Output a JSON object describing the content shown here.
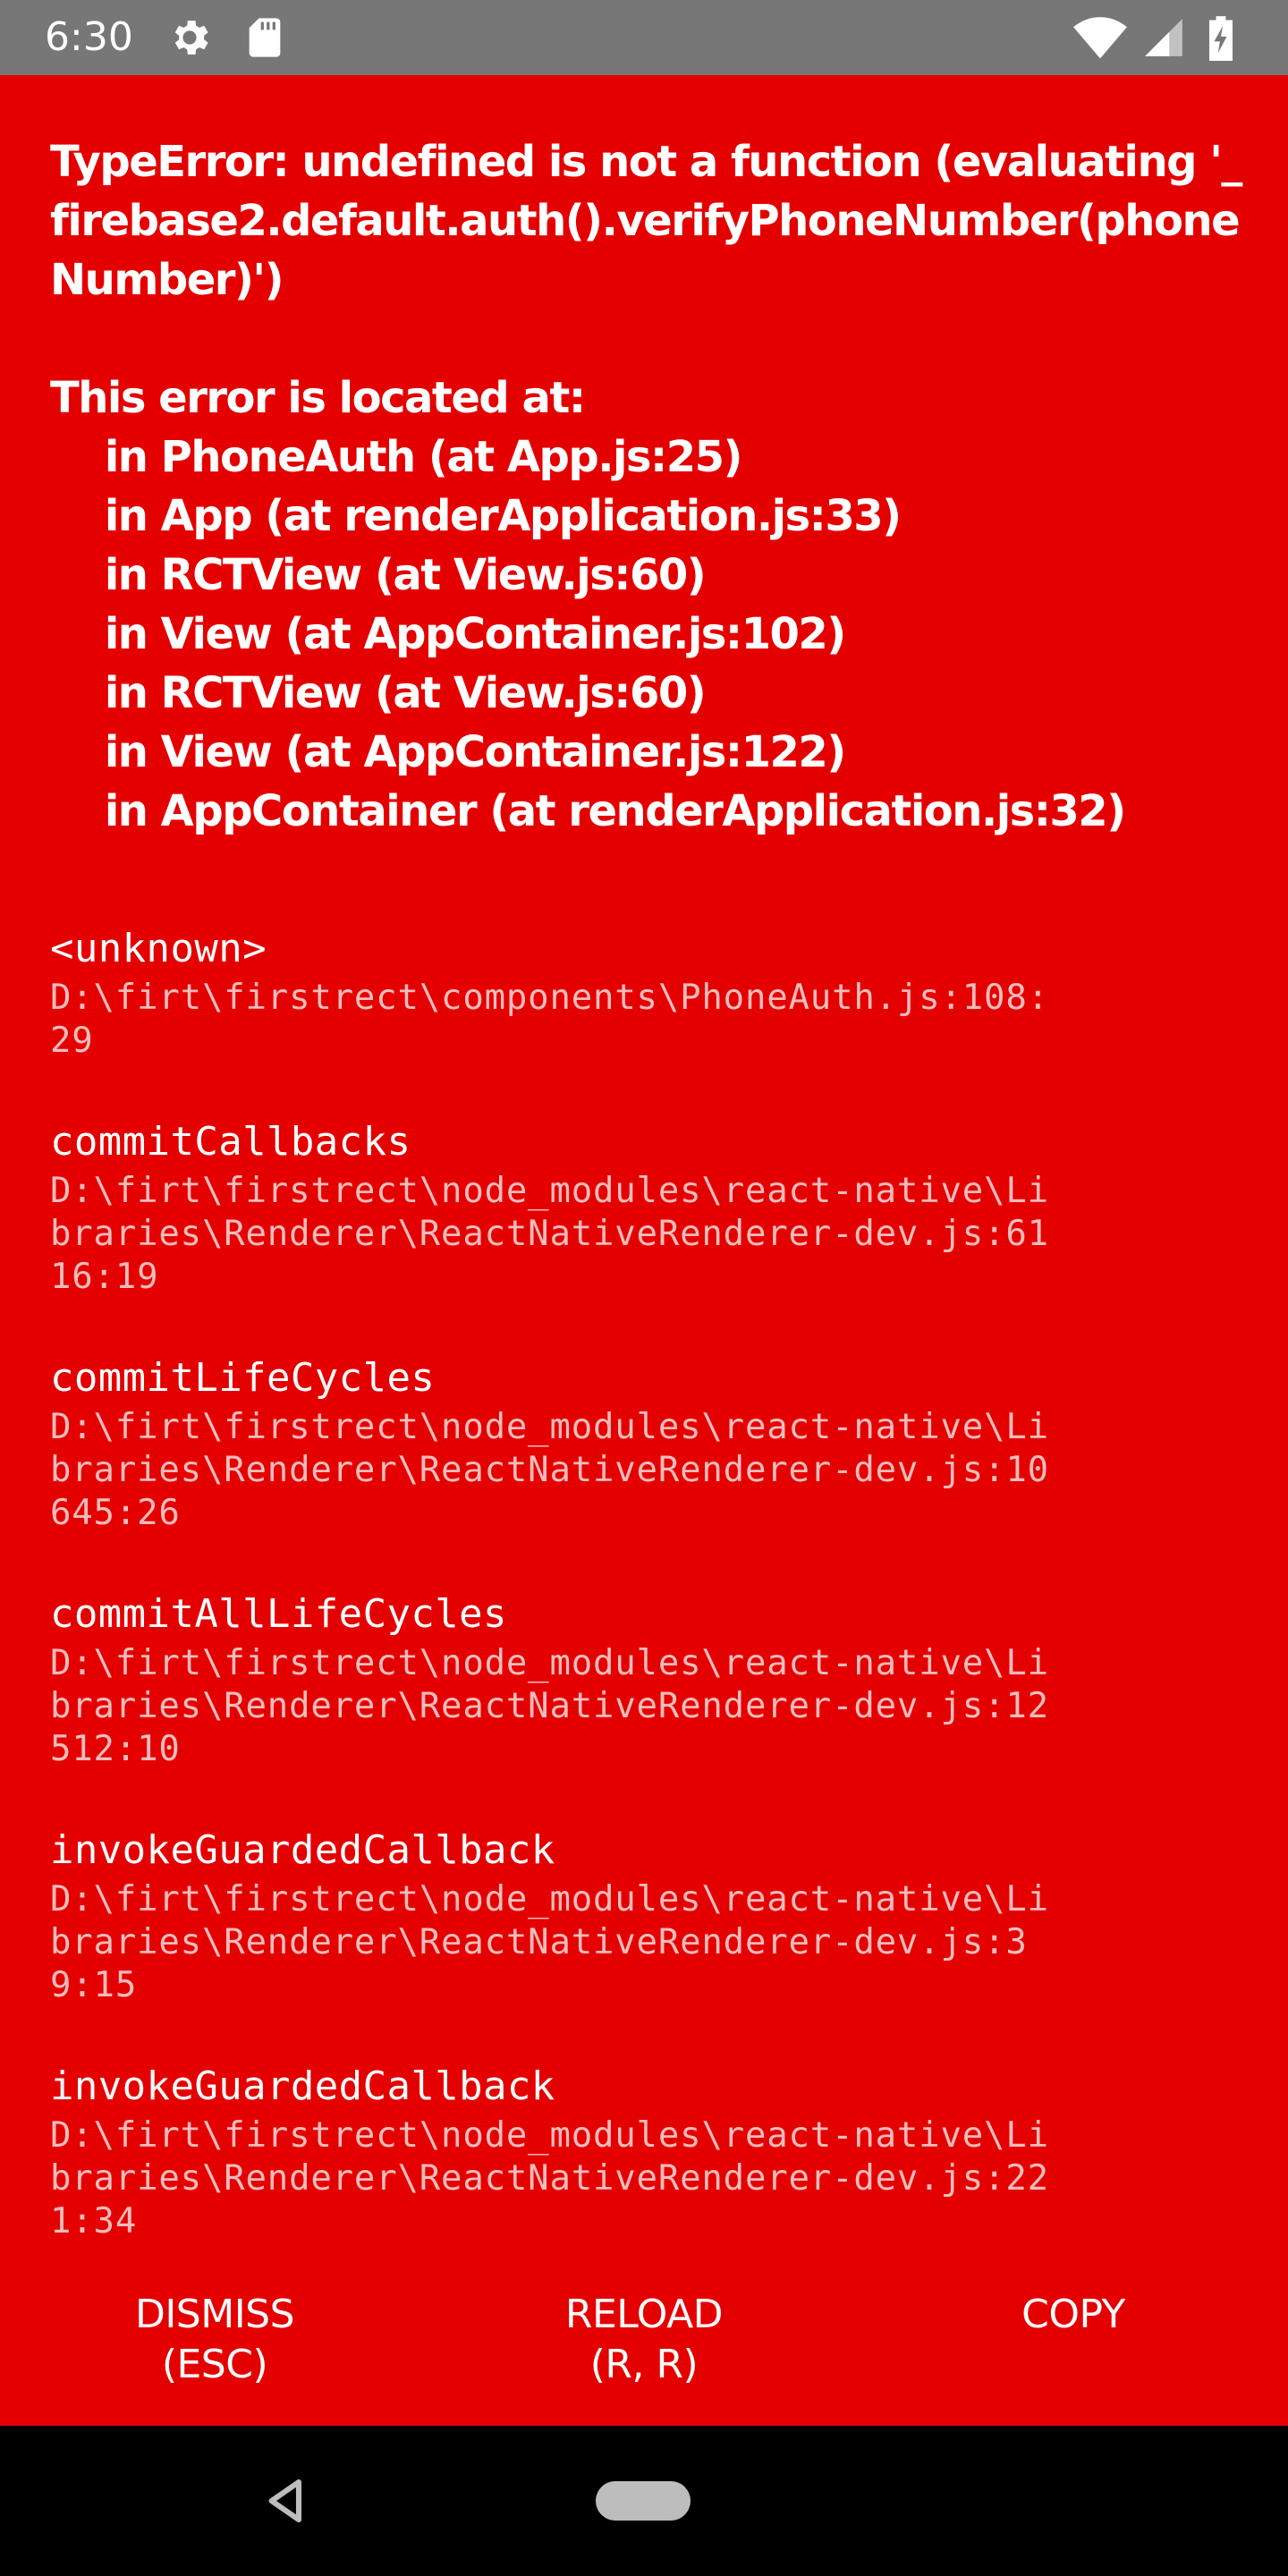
{
  "status_bar": {
    "time": "6:30",
    "icons": [
      "settings-icon",
      "sd-card-icon",
      "wifi-icon",
      "signal-icon",
      "battery-charging-icon"
    ]
  },
  "error": {
    "message": "TypeError: undefined is not a function (evaluating '_firebase2.default.auth().verifyPhoneNumber(phoneNumber)')\n\nThis error is located at:\n    in PhoneAuth (at App.js:25)\n    in App (at renderApplication.js:33)\n    in RCTView (at View.js:60)\n    in View (at AppContainer.js:102)\n    in RCTView (at View.js:60)\n    in View (at AppContainer.js:122)\n    in AppContainer (at renderApplication.js:32)"
  },
  "stack": [
    {
      "method": "<unknown>",
      "file": "D:\\firt\\firstrect\\components\\PhoneAuth.js:108:29"
    },
    {
      "method": "commitCallbacks",
      "file": "D:\\firt\\firstrect\\node_modules\\react-native\\Libraries\\Renderer\\ReactNativeRenderer-dev.js:6116:19"
    },
    {
      "method": "commitLifeCycles",
      "file": "D:\\firt\\firstrect\\node_modules\\react-native\\Libraries\\Renderer\\ReactNativeRenderer-dev.js:10645:26"
    },
    {
      "method": "commitAllLifeCycles",
      "file": "D:\\firt\\firstrect\\node_modules\\react-native\\Libraries\\Renderer\\ReactNativeRenderer-dev.js:12512:10"
    },
    {
      "method": "invokeGuardedCallback",
      "file": "D:\\firt\\firstrect\\node_modules\\react-native\\Libraries\\Renderer\\ReactNativeRenderer-dev.js:39:15"
    },
    {
      "method": "invokeGuardedCallback",
      "file": "D:\\firt\\firstrect\\node_modules\\react-native\\Libraries\\Renderer\\ReactNativeRenderer-dev.js:221:34"
    }
  ],
  "buttons": {
    "dismiss": "DISMISS\n(ESC)",
    "reload": "RELOAD\n(R, R)",
    "copy": "COPY"
  },
  "nav_bar": {
    "icons": [
      "back-icon",
      "home-pill"
    ]
  },
  "colors": {
    "background": "#e50000",
    "status_bar": "#777777",
    "file_text": "#f6bcbc",
    "nav_bar": "#000000"
  }
}
